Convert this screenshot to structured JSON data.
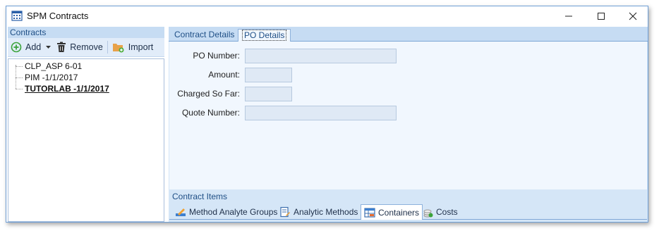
{
  "window": {
    "title": "SPM Contracts",
    "icons": {
      "app": "calendar-grid-icon",
      "minimize": "minimize-icon",
      "maximize": "maximize-icon",
      "close": "close-icon"
    }
  },
  "left_panel": {
    "header": "Contracts",
    "toolbar": {
      "add_label": "Add",
      "remove_label": "Remove",
      "import_label": "Import",
      "icons": {
        "add": "plus-circle-icon",
        "dropdown": "caret-down-icon",
        "remove": "trash-icon",
        "import": "folder-import-icon"
      }
    },
    "tree": {
      "items": [
        {
          "label": "CLP_ASP 6-01",
          "selected": false
        },
        {
          "label": "PIM -1/1/2017",
          "selected": false
        },
        {
          "label": "TUTORLAB -1/1/2017",
          "selected": true
        }
      ]
    }
  },
  "right_panel": {
    "tabs": [
      {
        "label": "Contract Details",
        "active": false
      },
      {
        "label": "PO Details",
        "active": true
      }
    ],
    "form": {
      "po_number": {
        "label": "PO Number:",
        "value": ""
      },
      "amount": {
        "label": "Amount:",
        "value": ""
      },
      "charged_so_far": {
        "label": "Charged So Far:",
        "value": ""
      },
      "quote_number": {
        "label": "Quote Number:",
        "value": ""
      }
    },
    "contract_items": {
      "header": "Contract Items",
      "tabs": [
        {
          "label": "Method Analyte Groups",
          "icon": "pencil-ruler-icon",
          "active": false
        },
        {
          "label": "Analytic Methods",
          "icon": "document-edit-icon",
          "active": false
        },
        {
          "label": "Containers",
          "icon": "table-grid-icon",
          "active": true
        },
        {
          "label": "Costs",
          "icon": "coins-icon",
          "active": false
        }
      ]
    }
  },
  "colors": {
    "window_border": "#6f9fd6",
    "panel_header_bg": "#c6dcf3",
    "form_bg": "#f1f7fe",
    "input_bg": "#dfe9f5",
    "add_green": "#3aa33a"
  }
}
